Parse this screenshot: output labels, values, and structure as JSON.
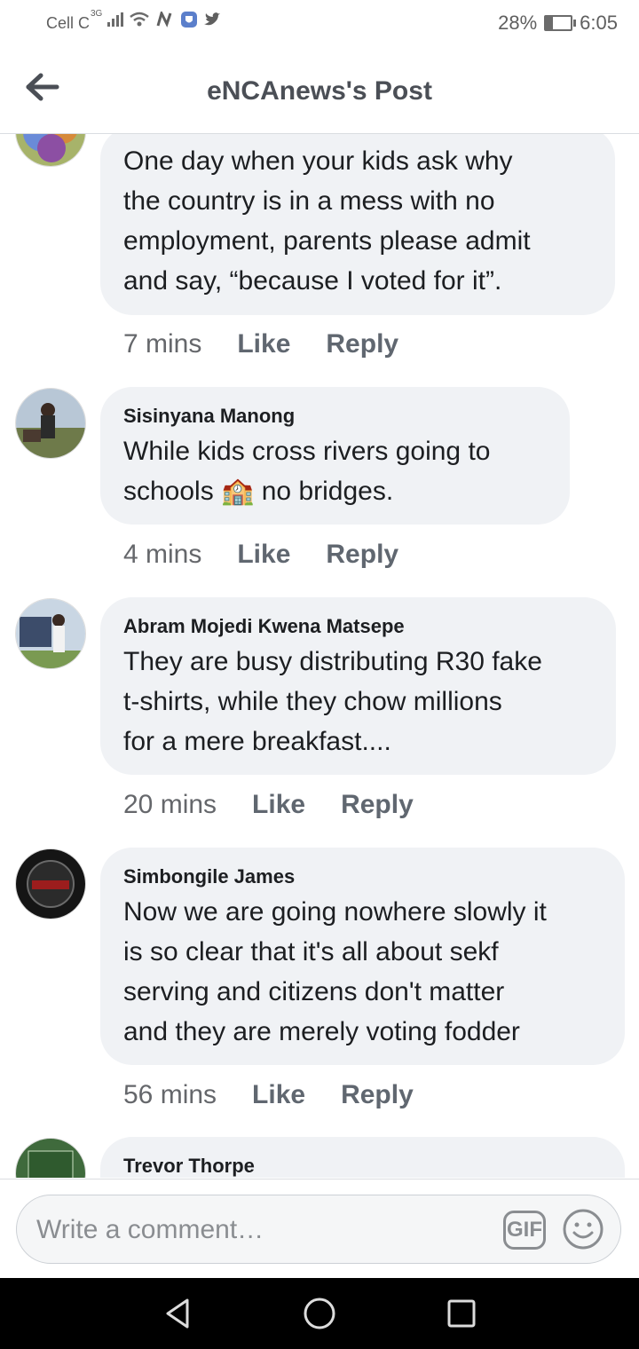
{
  "status_bar": {
    "carrier": "Cell C",
    "network": "3G",
    "battery_percent": "28%",
    "battery_level": 0.28,
    "time": "6:05",
    "icons": [
      "signal-icon",
      "wifi-icon",
      "nfc-icon",
      "shield-icon",
      "twitter-icon"
    ]
  },
  "header": {
    "title": "eNCAnews's Post",
    "back_icon": "arrow-left-icon"
  },
  "comments": [
    {
      "author": "",
      "text": "One day when your kids ask why\nthe country is in a mess with no\nemployment, parents please admit\nand say, “because I voted for it”.",
      "time": "7 mins",
      "like": "Like",
      "reply": "Reply"
    },
    {
      "author": "Sisinyana Manong",
      "text": "While kids cross rivers going  to\nschools 🏫 no bridges.",
      "time": "4 mins",
      "like": "Like",
      "reply": "Reply"
    },
    {
      "author": "Abram Mojedi Kwena Matsepe",
      "text": "They are busy distributing R30 fake\nt-shirts, while they chow millions\nfor a mere breakfast....",
      "time": "20 mins",
      "like": "Like",
      "reply": "Reply"
    },
    {
      "author": "Simbongile James",
      "text": "Now we are going nowhere slowly it\nis so clear that it's all about sekf\nserving and citizens don't matter\nand they are merely voting fodder",
      "time": "56 mins",
      "like": "Like",
      "reply": "Reply"
    },
    {
      "author": "Trevor Thorpe",
      "text": "",
      "time": "",
      "like": "",
      "reply": ""
    }
  ],
  "composer": {
    "placeholder": "Write a comment…",
    "gif_label": "GIF",
    "emoji_icon": "smiley-icon"
  },
  "nav_bar": {
    "icons": [
      "back-triangle-icon",
      "home-circle-icon",
      "recents-square-icon"
    ]
  },
  "colors": {
    "bubble": "#f0f2f5",
    "meta_text": "#65676b",
    "title_text": "#4b4f56"
  }
}
